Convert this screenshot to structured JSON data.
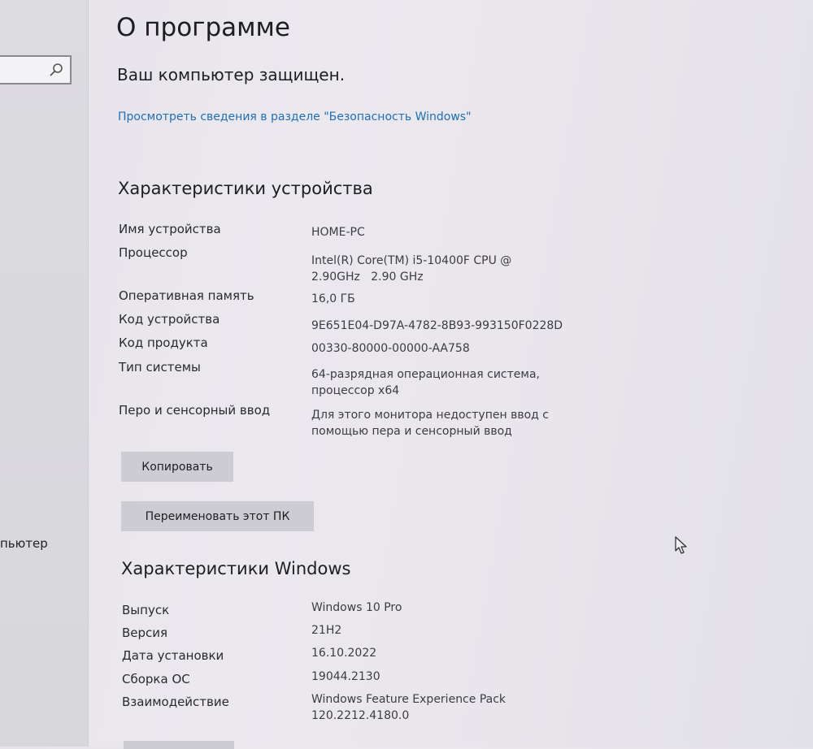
{
  "sidebar": {
    "search_icon": "search-icon",
    "item_label": "пьютер"
  },
  "header": {
    "title": "О программе"
  },
  "protection": {
    "status": "Ваш компьютер защищен.",
    "link": "Просмотреть сведения в разделе \"Безопасность Windows\""
  },
  "device_specs": {
    "title": "Характеристики устройства",
    "rows": [
      {
        "label": "Имя устройства",
        "value": "HOME-PC"
      },
      {
        "label": "Процессор",
        "value": "Intel(R) Core(TM) i5-10400F CPU @ 2.90GHz   2.90 GHz"
      },
      {
        "label": "Оперативная память",
        "value": "16,0 ГБ"
      },
      {
        "label": "Код устройства",
        "value": "9E651E04-D97A-4782-8B93-993150F0228D"
      },
      {
        "label": "Код продукта",
        "value": "00330-80000-00000-AA758"
      },
      {
        "label": "Тип системы",
        "value": "64-разрядная операционная система, процессор x64"
      },
      {
        "label": "Перо и сенсорный ввод",
        "value": "Для этого монитора недоступен ввод с помощью пера и сенсорный ввод"
      }
    ],
    "copy_button": "Копировать",
    "rename_button": "Переименовать этот ПК"
  },
  "windows_specs": {
    "title": "Характеристики Windows",
    "rows": [
      {
        "label": "Выпуск",
        "value": "Windows 10 Pro"
      },
      {
        "label": "Версия",
        "value": "21H2"
      },
      {
        "label": "Дата установки",
        "value": "16.10.2022"
      },
      {
        "label": "Сборка ОС",
        "value": "19044.2130"
      },
      {
        "label": "Взаимодействие",
        "value": "Windows Feature Experience Pack 120.2212.4180.0"
      }
    ]
  },
  "icons": {
    "cursor": "mouse-pointer-icon"
  }
}
